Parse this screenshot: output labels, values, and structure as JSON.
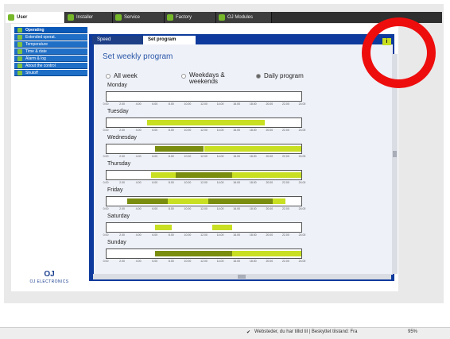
{
  "top_tabs": [
    {
      "label": "User"
    },
    {
      "label": "Installer"
    },
    {
      "label": "Service"
    },
    {
      "label": "Factory"
    },
    {
      "label": "OJ Modules"
    }
  ],
  "sidebar": {
    "items": [
      {
        "label": "Operating"
      },
      {
        "label": "Extended operat."
      },
      {
        "label": "Temperature"
      },
      {
        "label": "Time & date"
      },
      {
        "label": "Alarm & log"
      },
      {
        "label": "About the control"
      },
      {
        "label": "Shutoff"
      }
    ]
  },
  "logo": {
    "mark": "OJ",
    "text": "OJ ELECTRONICS"
  },
  "sub_tabs": [
    {
      "label": "Speed"
    },
    {
      "label": "Set program"
    }
  ],
  "page_title": "Set weekly program",
  "info_button": "i",
  "radios": [
    {
      "label": "All week",
      "selected": false
    },
    {
      "label": "Weekdays &",
      "label2": "weekends",
      "selected": false
    },
    {
      "label": "Daily program",
      "selected": true
    }
  ],
  "time_ticks": [
    "0.00",
    "2.00",
    "4.00",
    "6.00",
    "8.00",
    "10.00",
    "12.00",
    "14.00",
    "16.00",
    "18.00",
    "20.00",
    "22.00",
    "24.00"
  ],
  "colors": {
    "light": "#c8df22",
    "dark": "#7a8d0f",
    "accent": "#0d3a9c",
    "highlight_ring": "#ee0d0d"
  },
  "days": [
    {
      "name": "Monday",
      "segments": []
    },
    {
      "name": "Tuesday",
      "segments": [
        {
          "start": 5.0,
          "end": 19.5,
          "level": "light"
        }
      ]
    },
    {
      "name": "Wednesday",
      "segments": [
        {
          "start": 6.0,
          "end": 8.5,
          "level": "dark"
        },
        {
          "start": 8.5,
          "end": 12.0,
          "level": "dark"
        },
        {
          "start": 12.0,
          "end": 24.0,
          "level": "light"
        }
      ]
    },
    {
      "name": "Thursday",
      "segments": [
        {
          "start": 5.5,
          "end": 8.5,
          "level": "light"
        },
        {
          "start": 8.5,
          "end": 15.5,
          "level": "dark"
        },
        {
          "start": 15.5,
          "end": 24.0,
          "level": "light"
        }
      ]
    },
    {
      "name": "Friday",
      "segments": [
        {
          "start": 2.5,
          "end": 7.5,
          "level": "dark"
        },
        {
          "start": 7.5,
          "end": 12.5,
          "level": "light"
        },
        {
          "start": 12.5,
          "end": 20.5,
          "level": "dark"
        },
        {
          "start": 20.5,
          "end": 22.0,
          "level": "light"
        }
      ]
    },
    {
      "name": "Saturday",
      "segments": [
        {
          "start": 6.0,
          "end": 8.0,
          "level": "light"
        },
        {
          "start": 13.0,
          "end": 15.5,
          "level": "light"
        }
      ]
    },
    {
      "name": "Sunday",
      "segments": [
        {
          "start": 6.0,
          "end": 15.5,
          "level": "dark"
        },
        {
          "start": 15.5,
          "end": 24.0,
          "level": "light"
        }
      ]
    }
  ],
  "status_bar": {
    "text": "Websteder, du har tillid til | Beskyttet tilstand: Fra",
    "zoom": "95%"
  }
}
